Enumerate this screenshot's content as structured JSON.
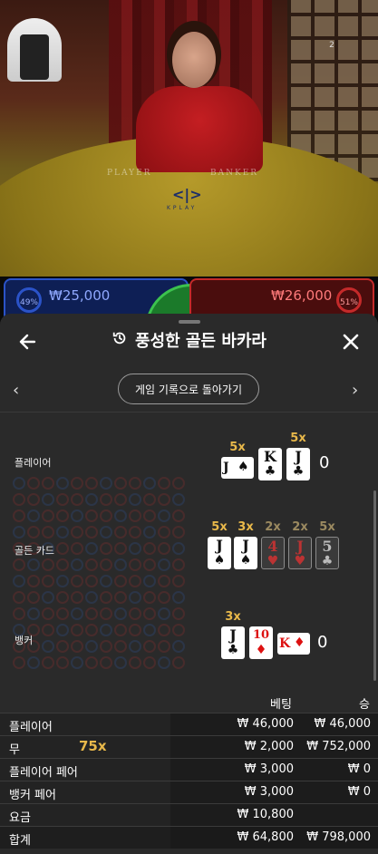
{
  "video": {
    "felt_player": "PLAYER",
    "felt_banker": "BANKER",
    "logo": "KPLAY",
    "badge": "2"
  },
  "bets": {
    "left_pct": "49%",
    "left_amount": "₩25,000",
    "right_pct": "51%",
    "right_amount": "₩26,000"
  },
  "panel": {
    "title": "풍성한 골든 바카라",
    "back_to_history": "게임 기록으로 돌아가기",
    "prev_arrow": "‹",
    "next_arrow": "›"
  },
  "hands": {
    "player": {
      "label": "플레이어",
      "score": "0",
      "cards": [
        {
          "rank": "J",
          "suit": "♠",
          "mult": "5x",
          "orientation": "sideways"
        },
        {
          "rank": "K",
          "suit": "♣",
          "mult": "",
          "orientation": "upright"
        },
        {
          "rank": "J",
          "suit": "♣",
          "mult": "5x",
          "orientation": "upright"
        }
      ]
    },
    "golden": {
      "label": "골든 카드",
      "cards": [
        {
          "rank": "J",
          "suit": "♠",
          "mult": "5x",
          "active": true
        },
        {
          "rank": "J",
          "suit": "♠",
          "mult": "3x",
          "active": true
        },
        {
          "rank": "4",
          "suit": "♥",
          "mult": "2x",
          "active": false
        },
        {
          "rank": "J",
          "suit": "♥",
          "mult": "2x",
          "active": false
        },
        {
          "rank": "5",
          "suit": "♣",
          "mult": "5x",
          "active": false
        }
      ]
    },
    "banker": {
      "label": "뱅커",
      "score": "0",
      "cards": [
        {
          "rank": "J",
          "suit": "♣",
          "mult": "3x",
          "orientation": "upright"
        },
        {
          "rank": "10",
          "suit": "♦",
          "mult": "",
          "orientation": "upright"
        },
        {
          "rank": "K",
          "suit": "♦",
          "mult": "",
          "orientation": "sideways"
        }
      ]
    }
  },
  "results": {
    "header_bet": "베팅",
    "header_win": "승",
    "rows": [
      {
        "name": "플레이어",
        "mult": "",
        "bet": "₩ 46,000",
        "win": "₩ 46,000"
      },
      {
        "name": "무",
        "mult": "75x",
        "bet": "₩ 2,000",
        "win": "₩ 752,000"
      },
      {
        "name": "플레이어 페어",
        "mult": "",
        "bet": "₩ 3,000",
        "win": "₩ 0"
      },
      {
        "name": "뱅커 페어",
        "mult": "",
        "bet": "₩ 3,000",
        "win": "₩ 0"
      },
      {
        "name": "요금",
        "mult": "",
        "bet": "₩ 10,800",
        "win": ""
      },
      {
        "name": "합계",
        "mult": "",
        "bet": "₩ 64,800",
        "win": "₩ 798,000"
      }
    ]
  },
  "colors": {
    "gold": "#e8b84a",
    "player_blue": "#2b53c8",
    "banker_red": "#c42a2a",
    "panel_bg": "#2a2a2a"
  }
}
